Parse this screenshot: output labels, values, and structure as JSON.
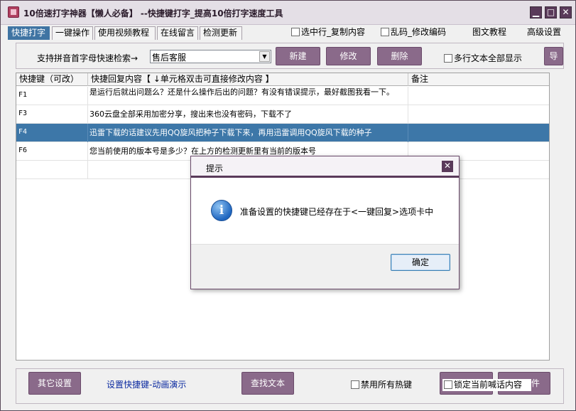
{
  "window": {
    "title": "10倍速打字神器【懒人必备】 --快捷键打字_提高10倍打字速度工具",
    "controls": {
      "minimize": "▁",
      "maximize": "□",
      "close": "✕"
    }
  },
  "tabs": [
    "快捷打字",
    "一键操作",
    "使用视频教程",
    "在线留言",
    "检测更新"
  ],
  "top_checks": {
    "select_copy": "选中行_复制内容",
    "garbled": "乱码_修改编码"
  },
  "top_links": {
    "tutorial": "图文教程",
    "advanced": "高级设置"
  },
  "search": {
    "label": "支持拼音首字母快速检索→",
    "combo_value": "售后客服"
  },
  "toolbar": {
    "new": "新建",
    "edit": "修改",
    "delete": "删除",
    "multiline": "多行文本全部显示",
    "export": "导"
  },
  "table": {
    "columns": [
      "快捷键（可改）",
      "快捷回复内容【 ↓单元格双击可直接修改内容 】",
      "备注"
    ],
    "rows": [
      {
        "key": "F1",
        "text": "是运行后就出问题么？还是什么操作后出的问题？有没有错误提示，最好截图我看一下。",
        "note": ""
      },
      {
        "key": "F3",
        "text": "360云盘全部采用加密分享，搜出来也没有密码，下载不了",
        "note": ""
      },
      {
        "key": "F4",
        "text": "迅雷下载的话建议先用QQ旋风把种子下载下来，再用迅雷调用QQ旋风下载的种子",
        "note": ""
      },
      {
        "key": "F6",
        "text": "您当前使用的版本号是多少？在上方的检测更新里有当前的版本号",
        "note": ""
      }
    ],
    "selected_row_index": 2
  },
  "bottom": {
    "other_settings": "其它设置",
    "shortcut_demo": "设置快捷键-动画演示",
    "find_text": "查找文本",
    "disable_hotkeys": "禁用所有热键",
    "lock_content": "锁定当前喊话内容",
    "partial_btn": "件"
  },
  "dialog": {
    "title": "提示",
    "message": "准备设置的快捷键已经存在于<一键回复>选项卡中",
    "ok": "确定",
    "icon": "info-icon"
  },
  "colors": {
    "accent": "#3d77a8",
    "button": "#8a6a8a",
    "titlebar_controls": "#5a3a5a"
  }
}
